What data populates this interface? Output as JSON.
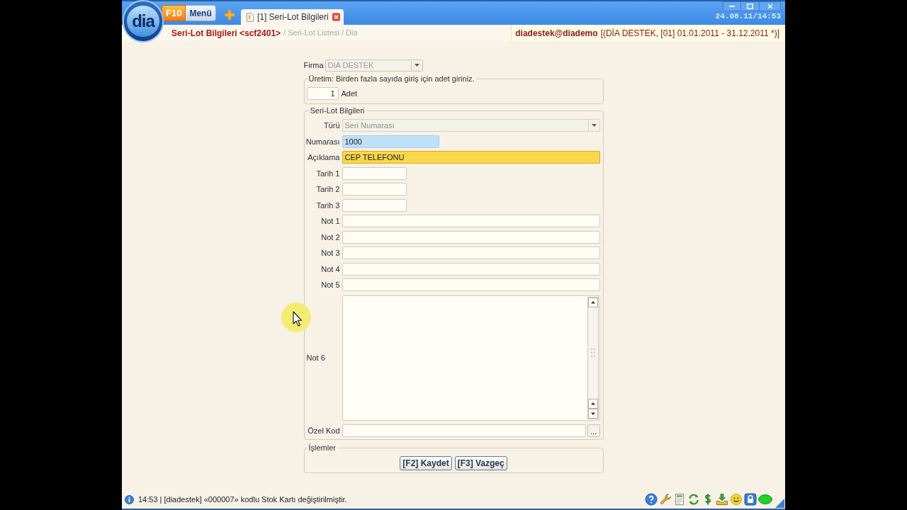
{
  "header": {
    "logo": "dia",
    "menu": {
      "key": "F10",
      "label": "Menü"
    },
    "tabs": [
      {
        "label": "[1] Seri-Lot Bilgileri",
        "selected": true
      }
    ],
    "clock": "24.08.11/14:53"
  },
  "breadcrumb": {
    "current": "Seri-Lot Bilgileri <scf2401>",
    "path": "/ Seri-Lot Listesi / Dia"
  },
  "session": {
    "user": "diadestek@diademo",
    "context": "[(DİA DESTEK, [01] 01.01.2011 - 31.12.2011 *)]"
  },
  "form": {
    "company": {
      "label": "Firma",
      "value": "DIA DESTEK",
      "disabled": true
    },
    "production": {
      "legend": "Üretim: Birden fazla sayıda giriş için adet giriniz.",
      "quantity": "1",
      "unit": "Adet"
    },
    "details": {
      "legend": "Seri-Lot Bilgileri",
      "fields": [
        {
          "kind": "select",
          "label": "Türü",
          "value": "Seri Numarası",
          "disabled": true,
          "focused": false,
          "highlighted": false
        },
        {
          "kind": "code",
          "label": "Numarası",
          "value": "1000",
          "disabled": false,
          "focused": false,
          "highlighted": true
        },
        {
          "kind": "text",
          "label": "Açıklama",
          "value": "CEP TELEFONU",
          "disabled": false,
          "focused": true,
          "highlighted": false
        },
        {
          "kind": "date",
          "label": "Tarih 1",
          "disabled": false,
          "focused": false,
          "highlighted": false
        },
        {
          "kind": "date",
          "label": "Tarih 2",
          "disabled": false,
          "focused": false,
          "highlighted": false
        },
        {
          "kind": "date",
          "label": "Tarih 3",
          "disabled": false,
          "focused": false,
          "highlighted": false
        },
        {
          "kind": "note",
          "label": "Not 1",
          "disabled": false,
          "focused": false,
          "highlighted": false
        },
        {
          "kind": "note",
          "label": "Not 2",
          "disabled": false,
          "focused": false,
          "highlighted": false
        },
        {
          "kind": "note",
          "label": "Not 3",
          "disabled": false,
          "focused": false,
          "highlighted": false
        },
        {
          "kind": "note",
          "label": "Not 4",
          "disabled": false,
          "focused": false,
          "highlighted": false
        },
        {
          "kind": "note",
          "label": "Not 5",
          "disabled": false,
          "focused": false,
          "highlighted": false
        },
        {
          "kind": "memo",
          "label": "Not 6",
          "disabled": false,
          "focused": false,
          "highlighted": false
        },
        {
          "kind": "lookup",
          "label": "Özel Kod",
          "button_label": "...",
          "disabled": false,
          "focused": false,
          "highlighted": false
        }
      ]
    },
    "actions": {
      "legend": "İşlemler",
      "buttons": [
        "[F2] Kaydet",
        "[F3] Vazgeç"
      ]
    }
  },
  "status_bar": {
    "message": "14:53 | [diadestek] «000007» kodlu Stok Kartı değiştirilmiştir."
  }
}
